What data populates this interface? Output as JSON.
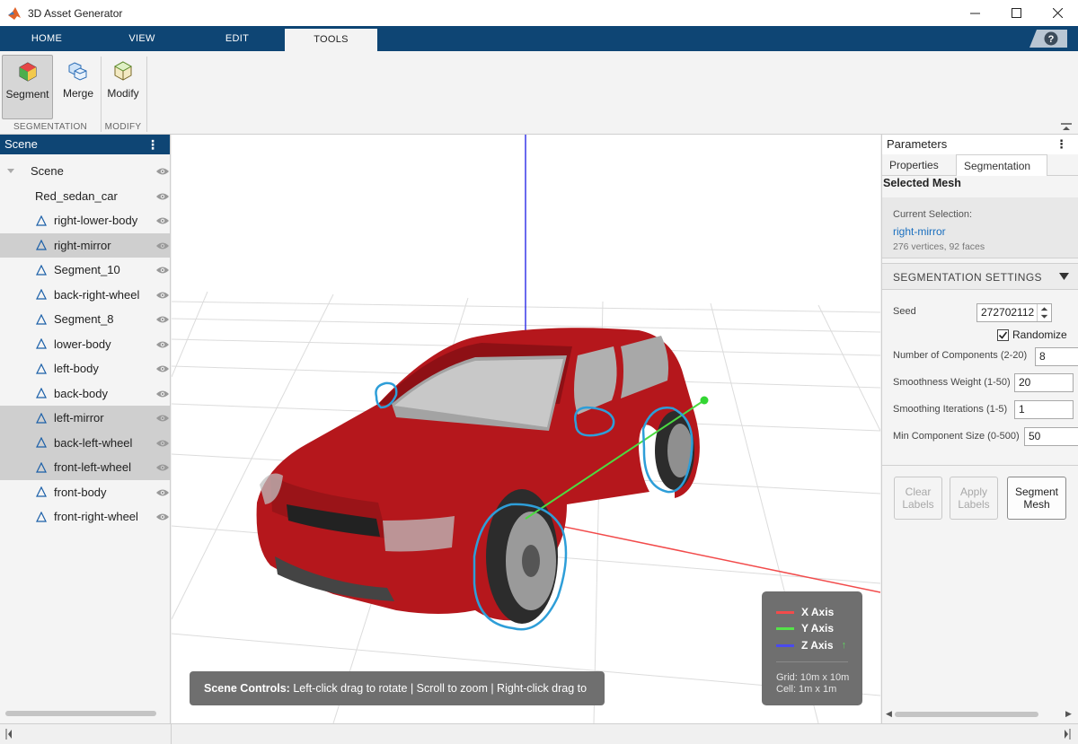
{
  "window": {
    "title": "3D Asset Generator"
  },
  "tabs": [
    {
      "label": "HOME",
      "active": false
    },
    {
      "label": "VIEW",
      "active": false
    },
    {
      "label": "EDIT",
      "active": false
    },
    {
      "label": "TOOLS",
      "active": true
    }
  ],
  "ribbon": {
    "segment_label": "Segment",
    "merge_label": "Merge",
    "modify_label": "Modify",
    "group_segmentation": "SEGMENTATION",
    "group_modify": "MODIFY"
  },
  "scene": {
    "title": "Scene",
    "root": "Scene",
    "model": "Red_sedan_car",
    "items": [
      {
        "label": "right-lower-body",
        "selected": false
      },
      {
        "label": "right-mirror",
        "selected": true
      },
      {
        "label": "Segment_10",
        "selected": false
      },
      {
        "label": "back-right-wheel",
        "selected": false
      },
      {
        "label": "Segment_8",
        "selected": false
      },
      {
        "label": "lower-body",
        "selected": false
      },
      {
        "label": "left-body",
        "selected": false
      },
      {
        "label": "back-body",
        "selected": false
      },
      {
        "label": "left-mirror",
        "selected": true
      },
      {
        "label": "back-left-wheel",
        "selected": true
      },
      {
        "label": "front-left-wheel",
        "selected": true
      },
      {
        "label": "front-body",
        "selected": false
      },
      {
        "label": "front-right-wheel",
        "selected": false
      }
    ]
  },
  "viewport": {
    "controls_bold": "Scene Controls:",
    "controls_text": " Left-click drag to rotate | Scroll to zoom | Right-click drag to pan",
    "legend": {
      "x": "X Axis",
      "y": "Y Axis",
      "z": "Z Axis",
      "z_arrow": "↑",
      "grid": "Grid: 10m x 10m",
      "cell": "Cell: 1m x 1m"
    },
    "colors": {
      "x_axis": "#f24b4b",
      "y_axis": "#55e24a",
      "z_axis": "#4a4aee",
      "highlight": "#2e9ed8",
      "car": "#b5171c"
    }
  },
  "params": {
    "title": "Parameters",
    "tab_properties": "Properties",
    "tab_segmentation": "Segmentation",
    "selected_mesh_title": "Selected Mesh",
    "current_selection_label": "Current Selection:",
    "current_selection_value": "right-mirror",
    "stats": "276 vertices, 92 faces",
    "settings_title": "SEGMENTATION SETTINGS",
    "seed_label": "Seed",
    "seed_value": "272702112",
    "randomize_label": "Randomize",
    "randomize_checked": true,
    "num_components_label": "Number of Components (2-20)",
    "num_components_value": "8",
    "smoothness_label": "Smoothness Weight (1-50)",
    "smoothness_value": "20",
    "iterations_label": "Smoothing Iterations (1-5)",
    "iterations_value": "1",
    "min_size_label": "Min Component Size (0-500)",
    "min_size_value": "50",
    "clear_label_1": "Clear",
    "clear_label_2": "Labels",
    "apply_label_1": "Apply",
    "apply_label_2": "Labels",
    "segment_label_1": "Segment",
    "segment_label_2": "Mesh"
  }
}
